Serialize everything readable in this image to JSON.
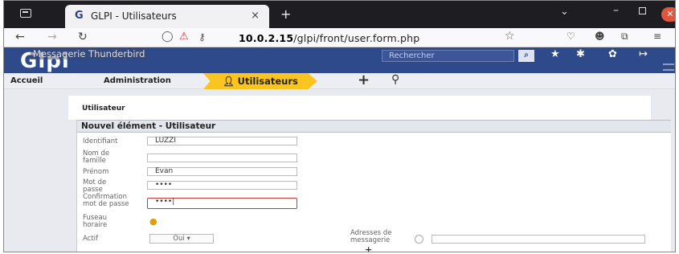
{
  "browser": {
    "tab_title": "GLPI - Utilisateurs",
    "favicon": "G",
    "tab_close": "×",
    "new_tab": "+",
    "url_host": "10.0.2.15",
    "url_path": "/glpi/front/user.form.php"
  },
  "glpi": {
    "logo": "Glpi",
    "tooltip": "Messagerie Thunderbird",
    "search_placeholder": "Rechercher"
  },
  "breadcrumb": {
    "home": "Accueil",
    "admin": "Administration",
    "current": "Utilisateurs"
  },
  "tab_label": "Utilisateur",
  "form": {
    "title": "Nouvel élément - Utilisateur",
    "fields": {
      "login_label": "Identifiant",
      "login_value": "LUZZI",
      "lastname_label": "Nom de famille",
      "lastname_value": "",
      "firstname_label": "Prénom",
      "firstname_value": "Evan",
      "password_label": "Mot de passe",
      "password_value": "••••",
      "confirm_label": "Confirmation mot de passe",
      "confirm_value": "••••|",
      "timezone_label": "Fuseau horaire",
      "active_label": "Actif",
      "active_value": "Oui",
      "email_label": "Adresses de messagerie"
    }
  }
}
